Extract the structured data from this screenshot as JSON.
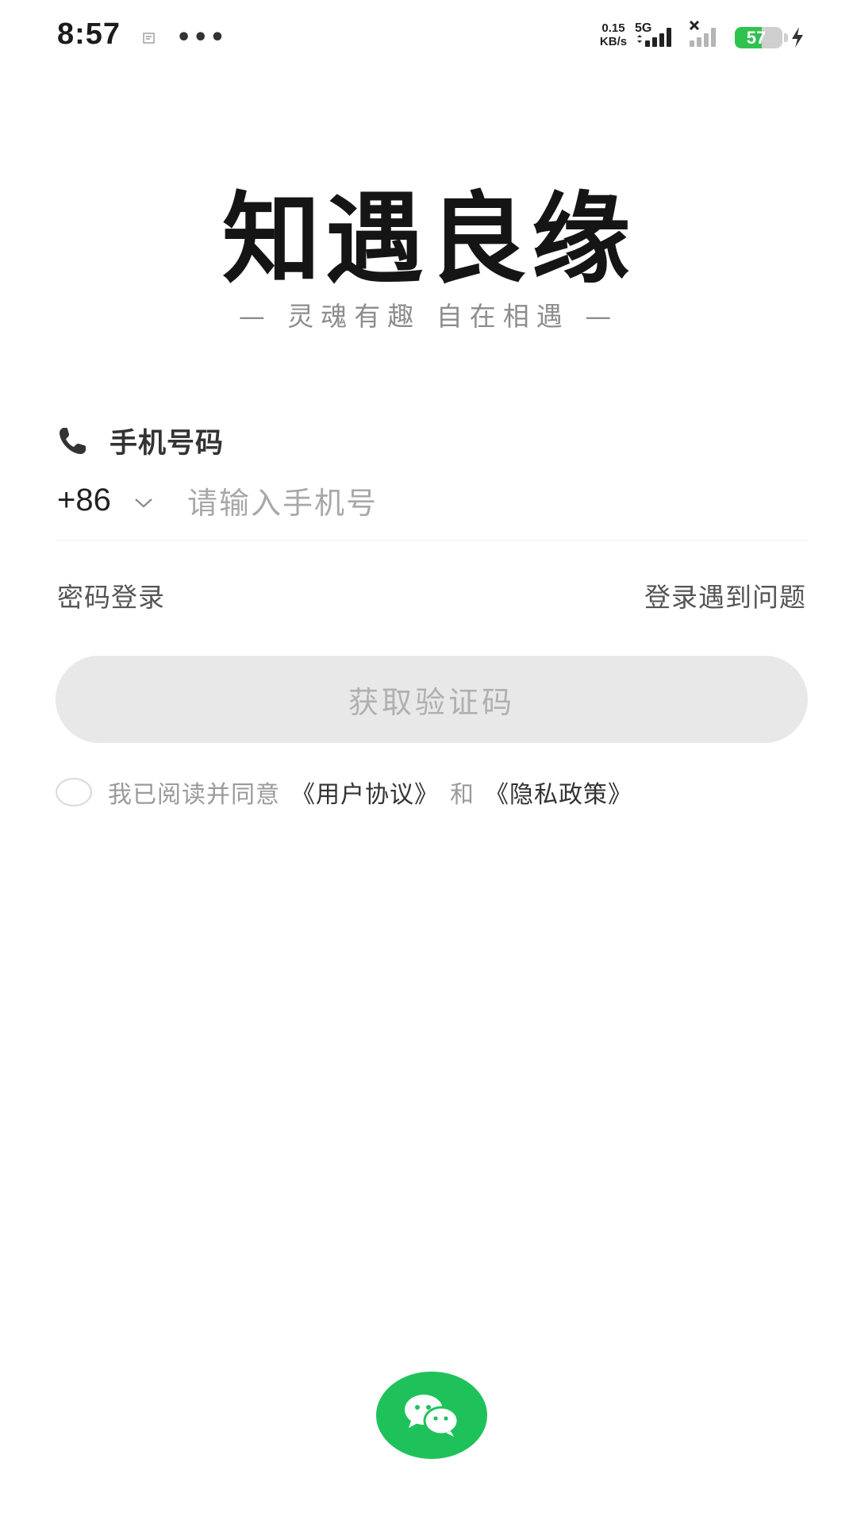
{
  "status_bar": {
    "time": "8:57",
    "more": "•••",
    "net_speed_value": "0.15",
    "net_speed_unit": "KB/s",
    "network_type": "5G",
    "battery_level": "57",
    "battery_percent": 57,
    "battery_color": "#2fc24e",
    "charging": true
  },
  "brand": {
    "title": "知遇良缘",
    "slogan": "— 灵魂有趣 自在相遇 —"
  },
  "phone": {
    "label": "手机号码",
    "icon": "phone-icon",
    "country_code": "+86",
    "placeholder": "请输入手机号",
    "value": ""
  },
  "links": {
    "password_login": "密码登录",
    "login_help": "登录遇到问题"
  },
  "cta": {
    "label": "获取验证码",
    "enabled": false
  },
  "agreement": {
    "checked": false,
    "prefix": "我已阅读并同意",
    "user_agreement": "《用户协议》",
    "and": "和",
    "privacy_policy": "《隐私政策》"
  },
  "third_party": {
    "wechat_icon": "wechat-icon",
    "wechat_color": "#1fc25a"
  }
}
